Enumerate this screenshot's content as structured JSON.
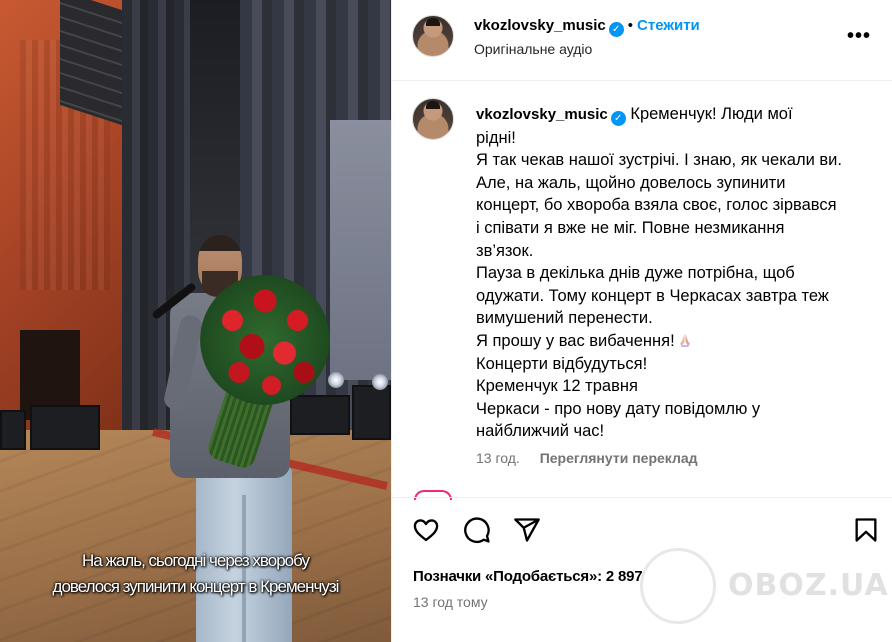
{
  "media": {
    "caption_line1": "На жаль, сьогодні через хворобу",
    "caption_line2": "довелося зупинити концерт в Кременчузі"
  },
  "header": {
    "username": "vkozlovsky_music",
    "separator": "•",
    "follow_label": "Стежити",
    "audio_label": "Оригінальне аудіо",
    "more_icon": "more-horizontal-icon"
  },
  "caption": {
    "username": "vkozlovsky_music",
    "lines": [
      "Кременчук! Люди мої",
      "рідні!",
      "Я так чекав нашої зустрічі. І знаю, як чекали ви.",
      "Але, на жаль, щойно довелось зупинити",
      "концерт, бо хвороба взяла своє, голос зірвався",
      "і співати я вже не міг. Повне незмикання",
      "зв’язок.",
      "Пауза в декілька днів дуже потрібна, щоб",
      "одужати. Тому концерт в Черкасах завтра теж",
      "вимушений перенести.",
      "Я прошу у вас вибачення!",
      "Концерти відбудуться!",
      "Кременчук 12 травня",
      "Черкаси - про нову дату повідомлю у",
      "найближчий час!"
    ],
    "age": "13 год.",
    "translate_label": "Переглянути переклад"
  },
  "actions": {
    "like_icon": "heart-icon",
    "comment_icon": "comment-icon",
    "share_icon": "share-icon",
    "save_icon": "bookmark-icon"
  },
  "likes_text": "Позначки «Подобається»: 2 897",
  "posted_time": "13 год тому",
  "watermark": "OBOZ.UA",
  "colors": {
    "link_blue": "#0095f6",
    "muted_text": "#737373",
    "divider": "#efefef"
  }
}
